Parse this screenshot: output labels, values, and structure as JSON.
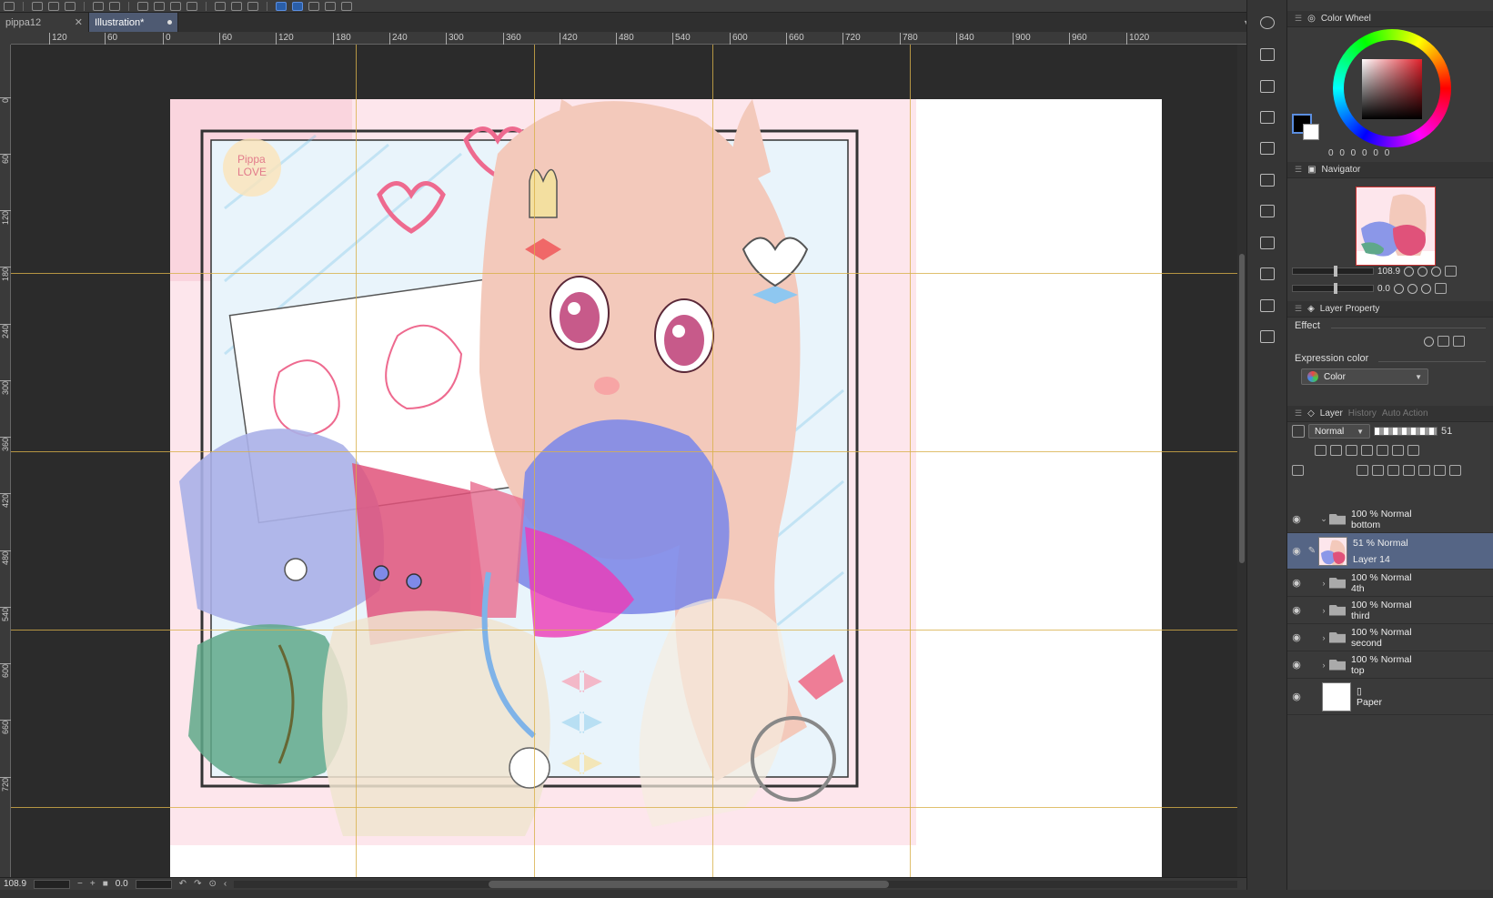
{
  "tabs": [
    {
      "label": "pippa12",
      "active": false
    },
    {
      "label": "Illustration*",
      "active": true
    }
  ],
  "ruler_h_labels": [
    "120",
    "60",
    "0",
    "60",
    "120",
    "180",
    "240",
    "300",
    "360",
    "420",
    "480",
    "540",
    "600",
    "660",
    "720",
    "780",
    "840",
    "900",
    "960",
    "1020"
  ],
  "ruler_v_labels": [
    "0",
    "60",
    "120",
    "180",
    "240",
    "300",
    "360",
    "420",
    "480",
    "540",
    "600",
    "660",
    "720"
  ],
  "status": {
    "zoom": "108.9",
    "rotation": "0.0"
  },
  "color_wheel": {
    "title": "Color Wheel",
    "readout": "0 0 0 0 0 0",
    "main_color": "#000000",
    "sub_color": "#ffffff"
  },
  "navigator": {
    "title": "Navigator",
    "zoom": "108.9",
    "angle": "0.0"
  },
  "layer_property": {
    "title": "Layer Property",
    "effect_label": "Effect",
    "expression_label": "Expression color",
    "expression_value": "Color"
  },
  "layer_panel": {
    "title": "Layer",
    "tabs_dim": [
      "History",
      "Auto Action"
    ],
    "blend_mode": "Normal",
    "opacity": "51",
    "layers": [
      {
        "line1": "100 % Normal",
        "line2": "bottom",
        "kind": "folder",
        "expanded": true,
        "selected": false
      },
      {
        "line1": "51 % Normal",
        "line2": "Layer 14",
        "kind": "raster",
        "expanded": false,
        "selected": true
      },
      {
        "line1": "100 % Normal",
        "line2": "4th",
        "kind": "folder",
        "expanded": false,
        "selected": false
      },
      {
        "line1": "100 % Normal",
        "line2": "third",
        "kind": "folder",
        "expanded": false,
        "selected": false
      },
      {
        "line1": "100 % Normal",
        "line2": "second",
        "kind": "folder",
        "expanded": false,
        "selected": false
      },
      {
        "line1": "100 % Normal",
        "line2": "top",
        "kind": "folder",
        "expanded": false,
        "selected": false
      },
      {
        "line1": "",
        "line2": "Paper",
        "kind": "paper",
        "expanded": false,
        "selected": false
      }
    ]
  },
  "artwork": {
    "caption": "Pippa LOVE",
    "accent": "#f4b8c6",
    "hair": "#f0c0b0",
    "blue": "#8b97e8",
    "pink": "#e0527a",
    "green": "#5fa88a"
  }
}
